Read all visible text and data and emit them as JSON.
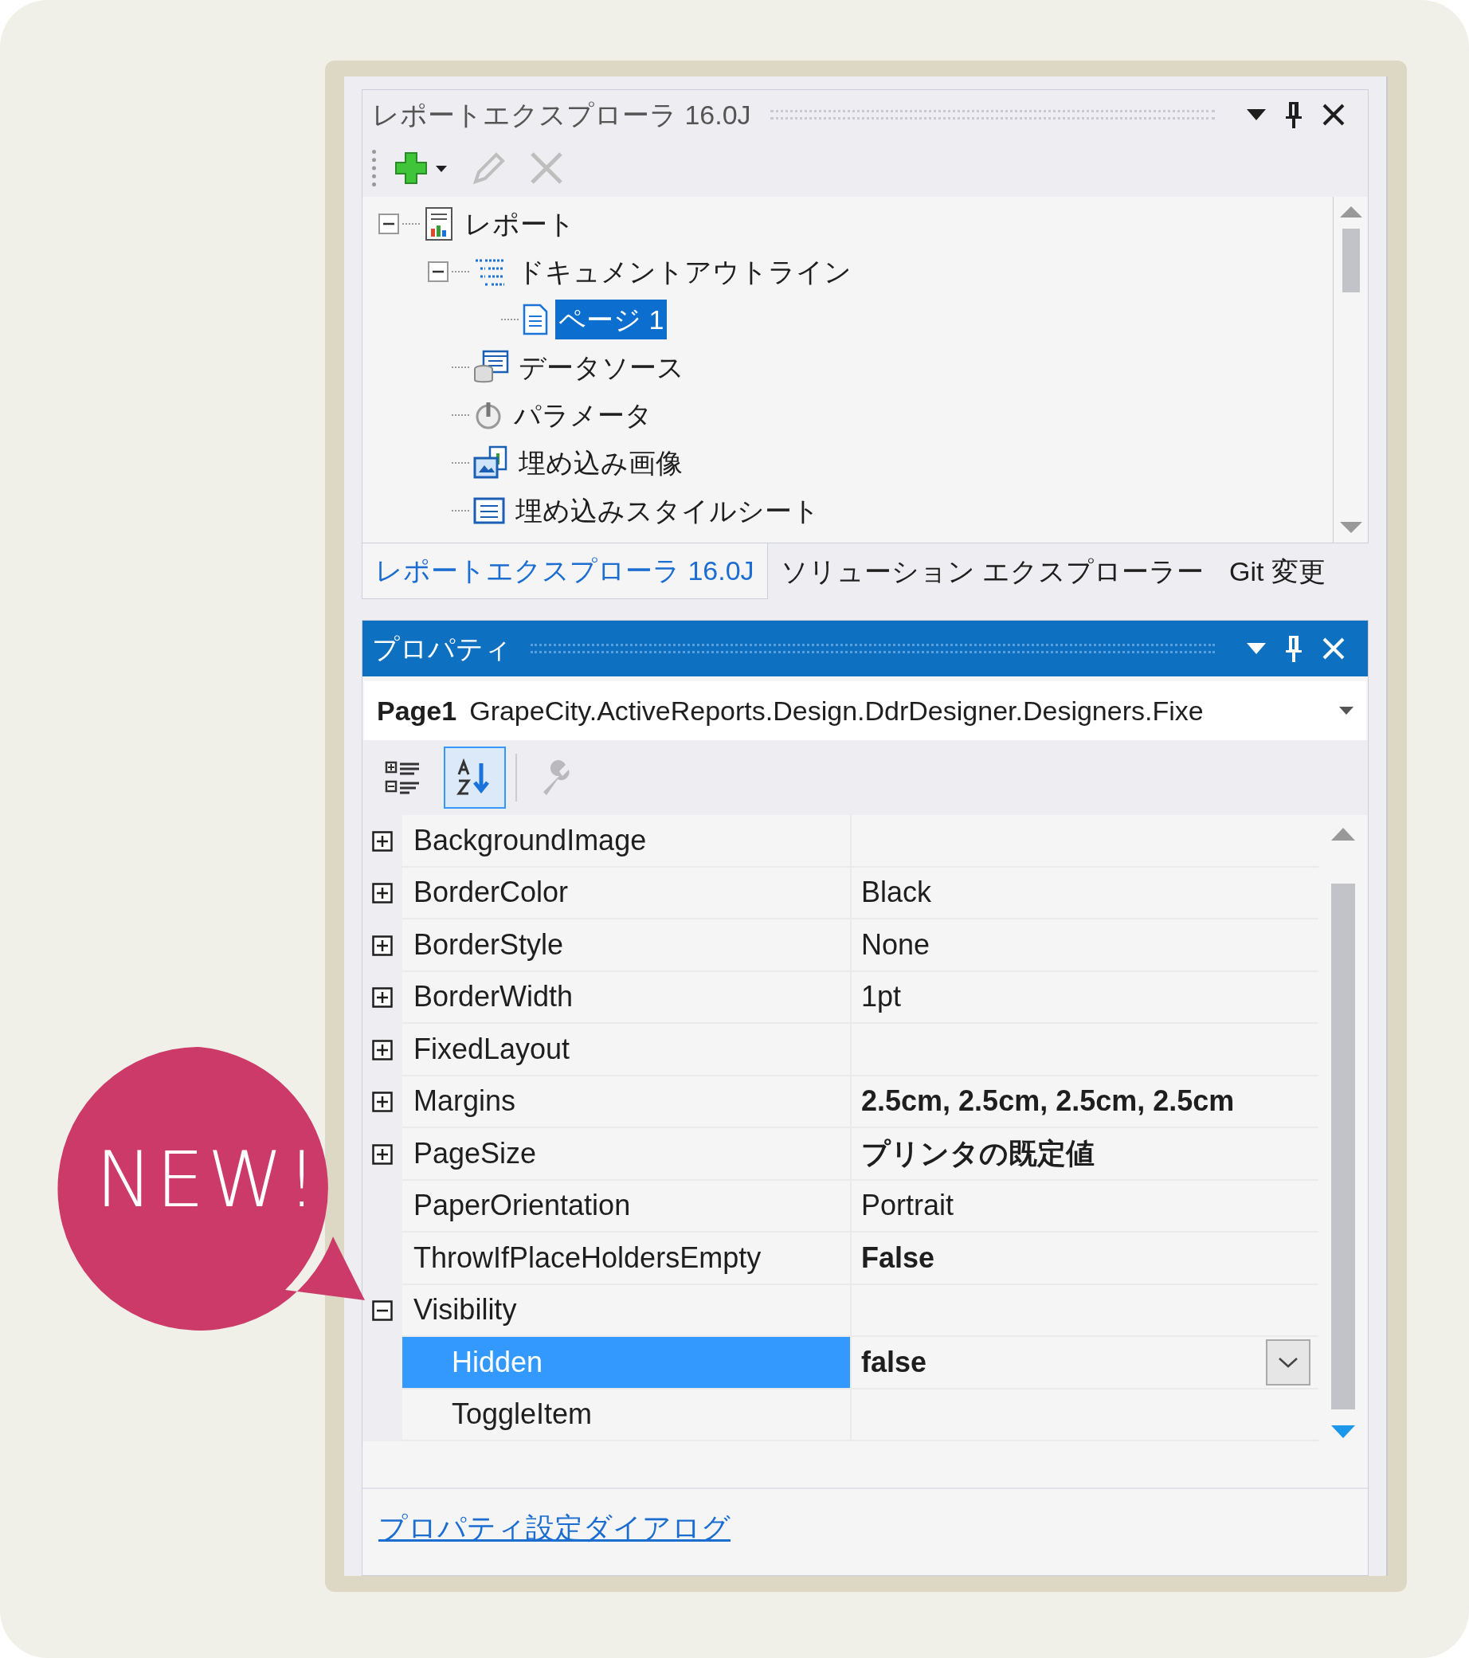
{
  "callout": {
    "text": "NEW!"
  },
  "explorer": {
    "title": "レポートエクスプローラ 16.0J",
    "toolbar": [
      {
        "kind": "add",
        "disabled": false
      },
      {
        "kind": "edit",
        "disabled": true
      },
      {
        "kind": "delete",
        "disabled": true
      }
    ],
    "tree": [
      {
        "label": "レポート",
        "kind": "report",
        "expanded": true,
        "selected": false,
        "children": [
          {
            "label": "ドキュメントアウトライン",
            "kind": "outline",
            "expanded": true,
            "selected": false,
            "children": [
              {
                "label": "ページ 1",
                "kind": "page",
                "selected": true
              }
            ]
          },
          {
            "label": "データソース",
            "kind": "datasource",
            "selected": false
          },
          {
            "label": "パラメータ",
            "kind": "parameter",
            "selected": false
          },
          {
            "label": "埋め込み画像",
            "kind": "image",
            "selected": false
          },
          {
            "label": "埋め込みスタイルシート",
            "kind": "stylesheet",
            "selected": false
          }
        ]
      }
    ]
  },
  "tabs": [
    {
      "label": "レポートエクスプローラ 16.0J",
      "selected": true
    },
    {
      "label": "ソリューション エクスプローラー",
      "selected": false
    },
    {
      "label": "Git 変更",
      "selected": false
    }
  ],
  "properties": {
    "title": "プロパティ",
    "object_name": "Page1",
    "object_type": "GrapeCity.ActiveReports.Design.DdrDesigner.Designers.Fixe",
    "toolbar": [
      {
        "kind": "categorized",
        "selected": false,
        "disabled": false
      },
      {
        "kind": "alphabetical",
        "selected": true,
        "disabled": false
      },
      {
        "kind": "property-pages",
        "selected": false,
        "disabled": true
      }
    ],
    "rows": [
      {
        "name": "BackgroundImage",
        "expanded": false,
        "selected": false
      },
      {
        "name": "BorderColor",
        "value": "Black",
        "expanded": false,
        "selected": false
      },
      {
        "name": "BorderStyle",
        "value": "None",
        "expanded": false,
        "selected": false
      },
      {
        "name": "BorderWidth",
        "value": "1pt",
        "expanded": false,
        "selected": false
      },
      {
        "name": "FixedLayout",
        "expanded": false,
        "selected": false
      },
      {
        "name": "Margins",
        "value": "2.5cm, 2.5cm, 2.5cm, 2.5cm",
        "bold": true,
        "expanded": false,
        "selected": false
      },
      {
        "name": "PageSize",
        "value": "プリンタの既定値",
        "bold": true,
        "expanded": false,
        "selected": false
      },
      {
        "name": "PaperOrientation",
        "value": "Portrait",
        "selected": false
      },
      {
        "name": "ThrowIfPlaceHoldersEmpty",
        "value": "False",
        "bold": true,
        "selected": false
      },
      {
        "name": "Visibility",
        "expanded": true,
        "selected": false,
        "children": [
          {
            "name": "Hidden",
            "value": "false",
            "bold": true,
            "selected": true,
            "dropdown": true
          },
          {
            "name": "ToggleItem",
            "selected": false
          }
        ]
      }
    ],
    "link": "プロパティ設定ダイアログ"
  }
}
